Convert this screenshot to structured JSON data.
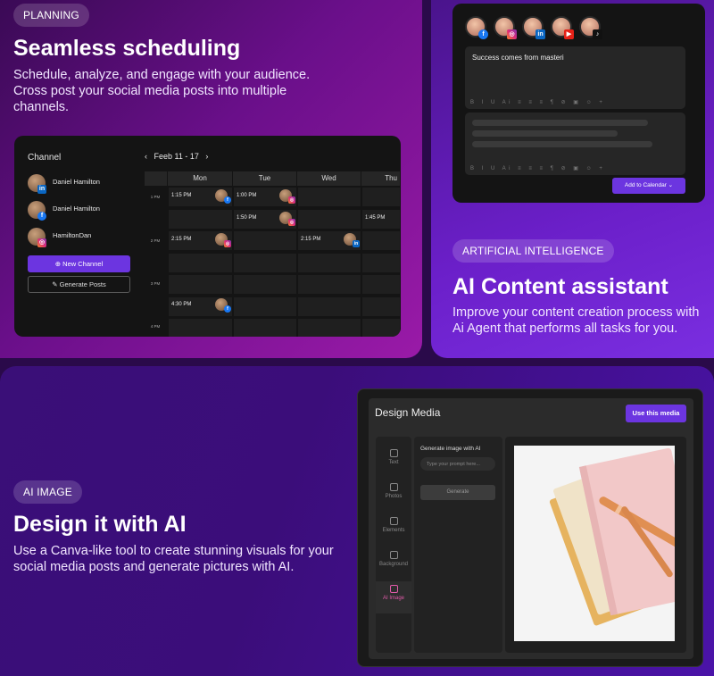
{
  "planning": {
    "pill": "PLANNING",
    "title": "Seamless scheduling",
    "description": "Schedule, analyze, and engage with your audience. Cross post your social media posts into multiple channels.",
    "calendar": {
      "channel_title": "Channel",
      "nav_label": "Feeb 11 - 17",
      "channels": [
        {
          "name": "Daniel Hamilton",
          "network": "linkedin-icon"
        },
        {
          "name": "Daniel Hamilton",
          "network": "facebook-icon"
        },
        {
          "name": "HamiltonDan",
          "network": "instagram-icon"
        }
      ],
      "new_channel_label": "New Channel",
      "generate_posts_label": "Generate Posts",
      "days": [
        "Mon",
        "Tue",
        "Wed",
        "Thu"
      ],
      "times": [
        "1 PM",
        "2 PM",
        "3 PM",
        "4 PM"
      ],
      "events": [
        {
          "time": "1:15 PM",
          "network": "facebook-icon"
        },
        {
          "time": "1:00 PM",
          "network": "instagram-icon"
        },
        {
          "time": "1:50 PM",
          "network": "instagram-icon"
        },
        {
          "time": "1:45 PM",
          "network": ""
        },
        {
          "time": "2:15 PM",
          "network": "instagram-icon"
        },
        {
          "time": "2:15 PM",
          "network": "linkedin-icon"
        },
        {
          "time": "4:30 PM",
          "network": "facebook-icon"
        }
      ]
    }
  },
  "ai": {
    "pill": "ARTIFICIAL INTELLIGENCE",
    "title": "AI Content assistant",
    "description": "Improve your content creation process with Ai Agent that performs all tasks for you.",
    "composer": {
      "networks": [
        "facebook-icon",
        "instagram-icon",
        "linkedin-icon",
        "youtube-icon",
        "tiktok-icon"
      ],
      "editor_text": "Success comes from masteri",
      "add_to_calendar_label": "Add to Calendar"
    }
  },
  "image": {
    "pill": "AI IMAGE",
    "title": "Design it with AI",
    "description": "Use a Canva-like tool to create stunning visuals for your social media posts and generate pictures with AI.",
    "editor": {
      "title": "Design Media",
      "use_media_label": "Use this media",
      "tools": [
        "Text",
        "Photos",
        "Elements",
        "Background",
        "AI Image"
      ],
      "active_tool": "AI Image",
      "generate_label": "Generate image with AI",
      "prompt_placeholder": "Type your prompt here...",
      "generate_button": "Generate"
    }
  },
  "colors": {
    "accent": "#6c35e0",
    "planning_gradient_end": "#9a1aa8",
    "ai_gradient_end": "#7a2ee0"
  }
}
